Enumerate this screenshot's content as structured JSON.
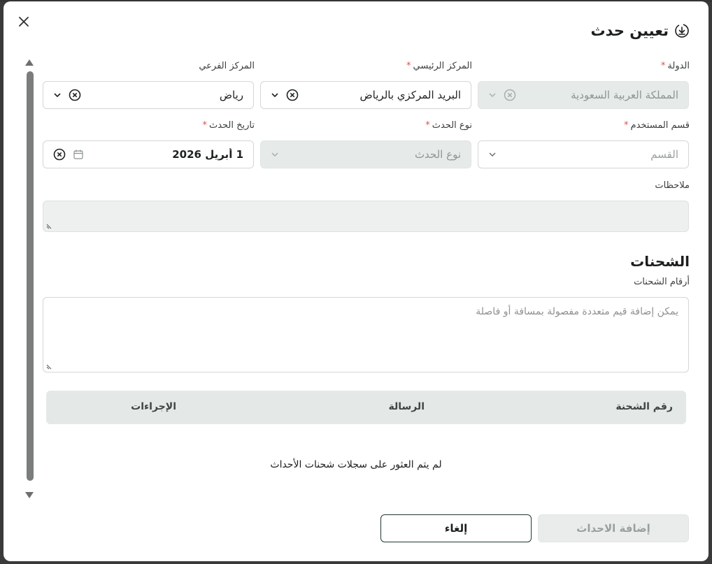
{
  "dialog": {
    "title": "تعيين حدث"
  },
  "form": {
    "country": {
      "label": "الدولة",
      "required": "*",
      "value": "المملكة العربية السعودية"
    },
    "main_center": {
      "label": "المركز الرئيسي",
      "required": "*",
      "value": "البريد المركزي بالرياض"
    },
    "sub_center": {
      "label": "المركز الفرعي",
      "value": "رياض"
    },
    "user_department": {
      "label": "قسم المستخدم",
      "required": "*",
      "placeholder": "القسم"
    },
    "event_type": {
      "label": "نوع الحدث",
      "required": "*",
      "placeholder": "نوع الحدث"
    },
    "event_date": {
      "label": "تاريخ الحدث",
      "required": "*",
      "value": "1 أبريل 2026"
    },
    "notes": {
      "label": "ملاحظات"
    }
  },
  "shipments": {
    "title": "الشحنات",
    "numbers_label": "أرقام الشحنات",
    "numbers_placeholder": "يمكن إضافة قيم متعددة مفصولة بمسافة أو فاصلة",
    "columns": [
      "رقم الشحنة",
      "الرسالة",
      "الإجراءات"
    ],
    "empty_message": "لم يتم العثور على سجلات شحنات الأحداث"
  },
  "actions": {
    "cancel": "إلغاء",
    "add_events": "إضافة الاحداث"
  }
}
